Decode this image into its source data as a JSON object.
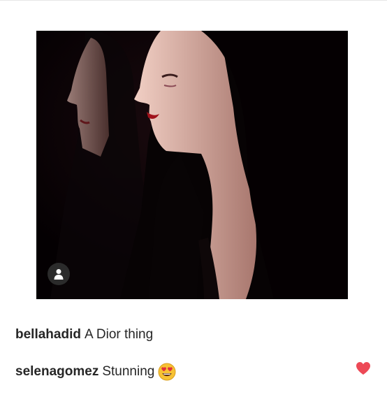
{
  "post": {
    "image_alt": "Two dark-haired models in black hooded coats in profile against a black background",
    "user_tag_icon": "person-icon"
  },
  "comments": [
    {
      "username": "bellahadid",
      "text": "A Dior thing"
    },
    {
      "username": "selenagomez",
      "text": "Stunning",
      "emoji": "smiling-face-with-heart-eyes"
    }
  ],
  "colors": {
    "background": "#ffffff",
    "text": "#262626",
    "like_heart": "#ed4956",
    "photo_background": "#050003"
  },
  "icons": {
    "like": "heart-icon",
    "emoji": "heart-eyes-emoji-icon"
  }
}
